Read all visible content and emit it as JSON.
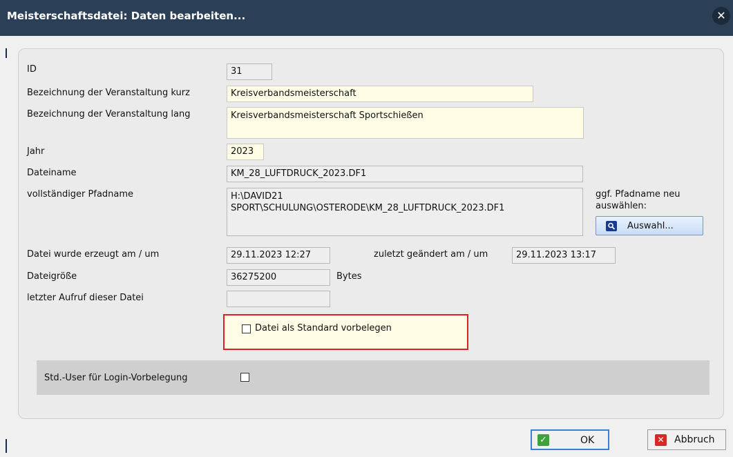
{
  "window": {
    "title": "Meisterschaftsdatei: Daten bearbeiten...",
    "close_icon": "close-icon"
  },
  "form": {
    "id_label": "ID",
    "id_value": "31",
    "kurz_label": "Bezeichnung der Veranstaltung kurz",
    "kurz_value": "Kreisverbandsmeisterschaft",
    "lang_label": "Bezeichnung der Veranstaltung lang",
    "lang_value": "Kreisverbandsmeisterschaft Sportschießen",
    "jahr_label": "Jahr",
    "jahr_value": "2023",
    "dateiname_label": "Dateiname",
    "dateiname_value": "KM_28_LUFTDRUCK_2023.DF1",
    "pfad_label": "vollständiger Pfadname",
    "pfad_value_line1": "H:\\DAVID21",
    "pfad_value_line2": "SPORT\\SCHULUNG\\OSTERODE\\KM_28_LUFTDRUCK_2023.DF1",
    "pfad_hint_line1": "ggf. Pfadname neu",
    "pfad_hint_line2": "auswählen:",
    "auswahl_button": "Auswahl...",
    "erzeugt_label": "Datei wurde erzeugt am / um",
    "erzeugt_value": "29.11.2023 12:27",
    "geaendert_label": "zuletzt geändert am / um",
    "geaendert_value": "29.11.2023 13:17",
    "groesse_label": "Dateigröße",
    "groesse_value": "36275200",
    "groesse_unit": "Bytes",
    "aufruf_label": "letzter Aufruf dieser Datei",
    "aufruf_value": "",
    "standard_checkbox_label": "Datei als Standard vorbelegen",
    "standard_checked": false,
    "std_user_label": "Std.-User für Login-Vorbelegung",
    "std_user_checked": false
  },
  "footer": {
    "ok_label": "OK",
    "cancel_label": "Abbruch"
  },
  "colors": {
    "titlebar": "#2b3f57",
    "highlight_border": "#e02020",
    "editable_field": "#fffde6"
  }
}
